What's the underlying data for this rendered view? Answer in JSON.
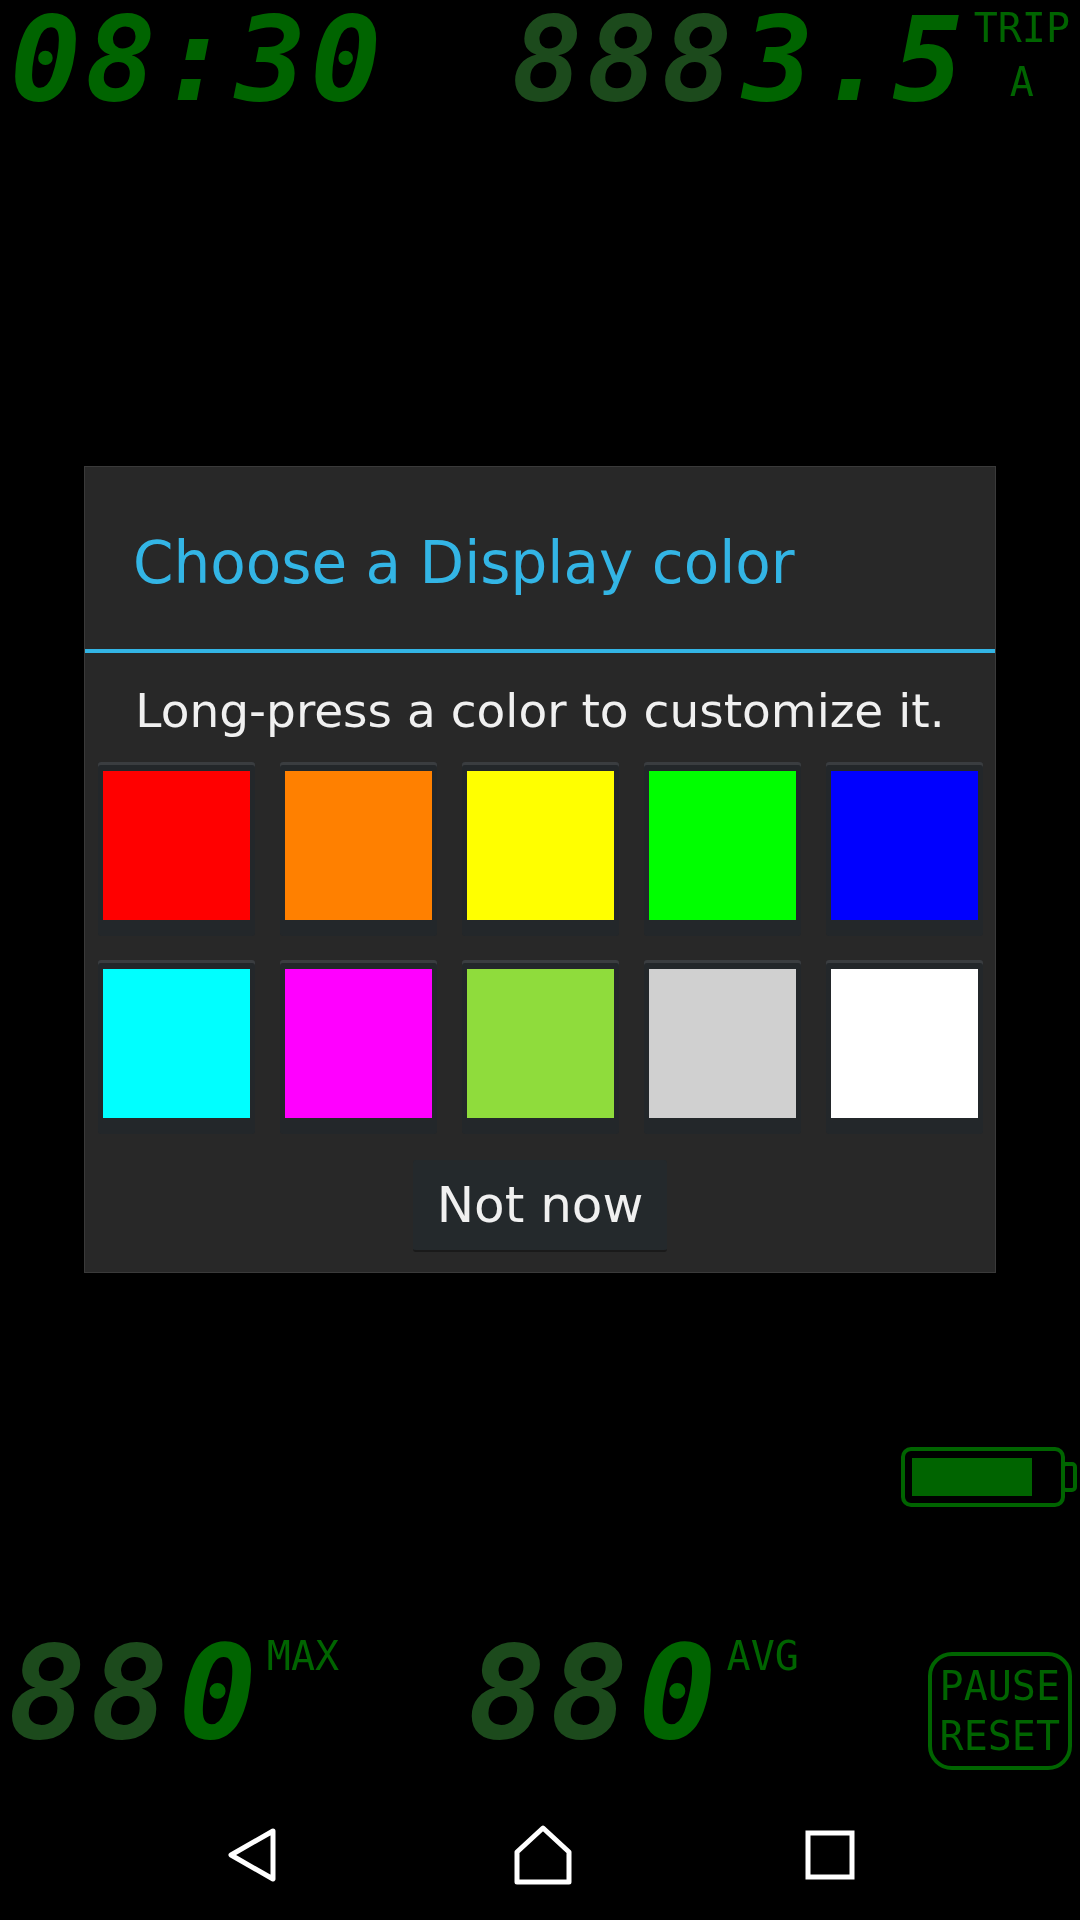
{
  "top_display": {
    "clock": "08:30",
    "trip_ghost": "888",
    "trip_value": "3.5",
    "trip_label": "TRIP",
    "trip_slot": "A"
  },
  "dialog": {
    "title": "Choose a Display color",
    "message": "Long-press a color to customize it.",
    "swatches": [
      {
        "color": "#ff0000"
      },
      {
        "color": "#ff8000"
      },
      {
        "color": "#ffff00"
      },
      {
        "color": "#00ff00"
      },
      {
        "color": "#0000ff"
      },
      {
        "color": "#00ffff"
      },
      {
        "color": "#ff00ff"
      },
      {
        "color": "#8fdc3c"
      },
      {
        "color": "#d0d0d0"
      },
      {
        "color": "#ffffff"
      }
    ],
    "button": "Not now"
  },
  "bottom_display": {
    "readouts": [
      {
        "ghost": "88",
        "value": "0",
        "label": "MAX"
      },
      {
        "ghost": "88",
        "value": "0",
        "label": "AVG"
      }
    ],
    "pause_button": [
      "PAUSE",
      "RESET"
    ]
  },
  "nav_bar": {
    "buttons": [
      {
        "kind": "back"
      },
      {
        "kind": "home"
      },
      {
        "kind": "recents"
      }
    ]
  }
}
